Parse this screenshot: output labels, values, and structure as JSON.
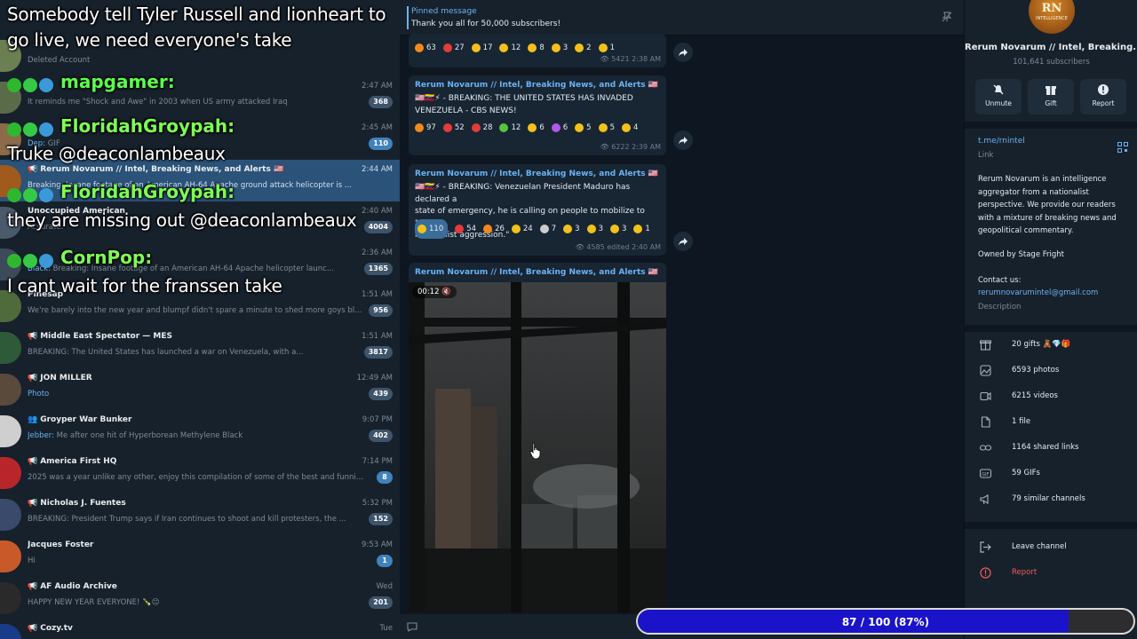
{
  "overlay": [
    {
      "text": "Somebody tell Tyler Russell and lionheart to",
      "kind": "msg"
    },
    {
      "text": "go live, we need everyone's take",
      "kind": "msg"
    },
    {
      "user": "mapgamer:",
      "color": "#5bff4d"
    },
    {
      "user": "FloridahGroypah:",
      "color": "#7dff55"
    },
    {
      "text": "Truke @deaconlambeaux",
      "kind": "msg"
    },
    {
      "user": "FloridahGroypah:",
      "color": "#7dff55"
    },
    {
      "text": "they are missing out @deaconlambeaux",
      "kind": "msg"
    },
    {
      "user": "CornPop:",
      "color": "#7dff55"
    },
    {
      "text": "I cant wait for the franssen take",
      "kind": "msg"
    }
  ],
  "chats": [
    {
      "name": "",
      "preview": "Deleted Account",
      "time": "",
      "badge": "",
      "avatar": "#6b7f52"
    },
    {
      "name": "",
      "preview": "It reminds me \"Shock and Awe\" in 2003 when US army attacked Iraq",
      "time": "2:47 AM",
      "badge": "368",
      "avatar": "#5a6b4a"
    },
    {
      "name": "",
      "sender": "Dep:",
      "preview": "GIF",
      "time": "2:45 AM",
      "badge": "110",
      "badge_blue": true,
      "avatar": "#8b6b4a"
    },
    {
      "name": "Rerum Novarum // Intel, Breaking News, and Alerts 🇺🇸",
      "kind": "📢",
      "preview": "Breaking: Insane footage of an American AH-64 Apache ground attack helicopter is ...",
      "time": "2:44 AM",
      "badge": "",
      "active": true,
      "avatar": "#a05a1c"
    },
    {
      "name": "Unoccupied American",
      "preview": "Accurate.",
      "time": "2:40 AM",
      "badge": "4004",
      "avatar": "#4a5a6b"
    },
    {
      "name": "",
      "sender": "Black:",
      "preview": "Breaking: Insane footage of an American AH-64 Apache helicopter launc...",
      "time": "2:36 AM",
      "badge": "1365",
      "avatar": "#3c4a5a"
    },
    {
      "name": "Pinesap",
      "preview": "We're barely into the new year and blumpf didn't spare a minute to shed more goys blood.",
      "time": "1:51 AM",
      "badge": "956",
      "avatar": "#4f6b3c"
    },
    {
      "name": "Middle East Spectator — MES",
      "kind": "📢",
      "preview": "BREAKING: The United States has launched a war on Venezuela, with a...",
      "time": "1:51 AM",
      "badge": "3817",
      "avatar": "#2f5a3a"
    },
    {
      "name": "JON MILLER",
      "kind": "📢",
      "preview": "Photo",
      "preview_blue": true,
      "time": "12:49 AM",
      "badge": "439",
      "avatar": "#5a4a3c"
    },
    {
      "name": "Groyper War Bunker",
      "kind": "👥",
      "sender": "Jebber:",
      "preview": "Me after one hit of Hyperborean Methylene Black",
      "time": "9:07 PM",
      "badge": "402",
      "avatar": "#cfcfcf"
    },
    {
      "name": "America First HQ",
      "kind": "📢",
      "preview": "2025 was a year unlike any other, enjoy this compilation of some of the best and funniest mo...",
      "time": "7:14 PM",
      "badge": "8",
      "badge_blue": true,
      "avatar": "#b8262c"
    },
    {
      "name": "Nicholas J. Fuentes",
      "kind": "📢",
      "preview": "BREAKING: President Trump says if Iran continues to shoot and kill protesters, the ...",
      "time": "5:32 PM",
      "badge": "152",
      "avatar": "#3a4a6a"
    },
    {
      "name": "Jacques Foster",
      "preview": "Hi",
      "time": "9:53 AM",
      "badge": "1",
      "badge_blue": true,
      "avatar": "#c85a2a"
    },
    {
      "name": "AF Audio Archive",
      "kind": "📢",
      "preview": "HAPPY NEW YEAR EVERYONE! 🍾😊",
      "time": "Wed",
      "badge": "201",
      "avatar": "#2a2a2a"
    },
    {
      "name": "Cozy.tv",
      "kind": "📢",
      "preview": "",
      "time": "Tue",
      "badge": "",
      "avatar": "#1a3a8a"
    }
  ],
  "pinned": {
    "title": "Pinned message",
    "text": "Thank you all for 50,000 subscribers!"
  },
  "messages": [
    {
      "channel": "",
      "text": [],
      "reactions": [
        [
          "#f28a1a",
          "63"
        ],
        [
          "#e43b3b",
          "27"
        ],
        [
          "#f2c21a",
          "17"
        ],
        [
          "#f2c21a",
          "12"
        ],
        [
          "#f2c21a",
          "8"
        ],
        [
          "#f2c21a",
          "3"
        ],
        [
          "#f2c21a",
          "2"
        ],
        [
          "#f2c21a",
          "1"
        ]
      ],
      "views": "5421",
      "time": "2:38 AM"
    },
    {
      "channel": "Rerum Novarum // Intel, Breaking News, and Alerts 🇺🇸",
      "text": [
        "🇺🇸🇻🇪⚡ - BREAKING: THE UNITED STATES HAS INVADED",
        "VENEZUELA - CBS NEWS!"
      ],
      "reactions": [
        [
          "#f28a1a",
          "97"
        ],
        [
          "#e43b3b",
          "52"
        ],
        [
          "#e43b3b",
          "28"
        ],
        [
          "#5bc23b",
          "12"
        ],
        [
          "#f2c21a",
          "6"
        ],
        [
          "#b05ae4",
          "6"
        ],
        [
          "#f2c21a",
          "5"
        ],
        [
          "#f2c21a",
          "5"
        ],
        [
          "#f2c21a",
          "4"
        ]
      ],
      "views": "6222",
      "time": "2:39 AM"
    },
    {
      "channel": "Rerum Novarum // Intel, Breaking News, and Alerts 🇺🇸",
      "text": [
        "🇺🇸🇻🇪⚡ - BREAKING: Venezuelan President Maduro has declared a",
        "state of emergency, he is calling on people to mobilize to \"defeat",
        "imperialist aggression.\""
      ],
      "reactions": [
        [
          "#f2c21a",
          "110"
        ],
        [
          "#e43b3b",
          "54"
        ],
        [
          "#f28a1a",
          "26"
        ],
        [
          "#f2c21a",
          "24"
        ],
        [
          "#cccccc",
          "7"
        ],
        [
          "#f2c21a",
          "3"
        ],
        [
          "#f2c21a",
          "3"
        ],
        [
          "#f2c21a",
          "3"
        ],
        [
          "#f2c21a",
          "1"
        ]
      ],
      "views": "4585",
      "time": "edited 2:40 AM"
    }
  ],
  "video_msg": {
    "channel": "Rerum Novarum // Intel, Breaking News, and Alerts 🇺🇸",
    "duration": "00:12"
  },
  "info": {
    "logo_text": "RN",
    "logo_sub": "INTELLIGENCE",
    "title": "Rerum Novarum // Intel, Breaking...",
    "subscribers": "101,641 subscribers",
    "actions": [
      "Unmute",
      "Gift",
      "Report"
    ],
    "link": "t.me/rnintel",
    "link_label": "Link",
    "description": "Rerum Novarum is an intelligence aggregator from a nationalist perspective. We provide our readers with a mixture of breaking news and geopolitical commentary.",
    "owned": "Owned by Stage Fright",
    "contact": "Contact us:",
    "email": "rerumnovarumintel@gmail.com",
    "desc_label": "Description",
    "stats": [
      "20 gifts 🧸💎🎁",
      "6593 photos",
      "6215 videos",
      "1 file",
      "1164 shared links",
      "59 GIFs",
      "79 similar channels"
    ],
    "leave": "Leave channel",
    "report": "Report"
  },
  "progress": {
    "text": "87 / 100 (87%)",
    "value": 0.87
  }
}
